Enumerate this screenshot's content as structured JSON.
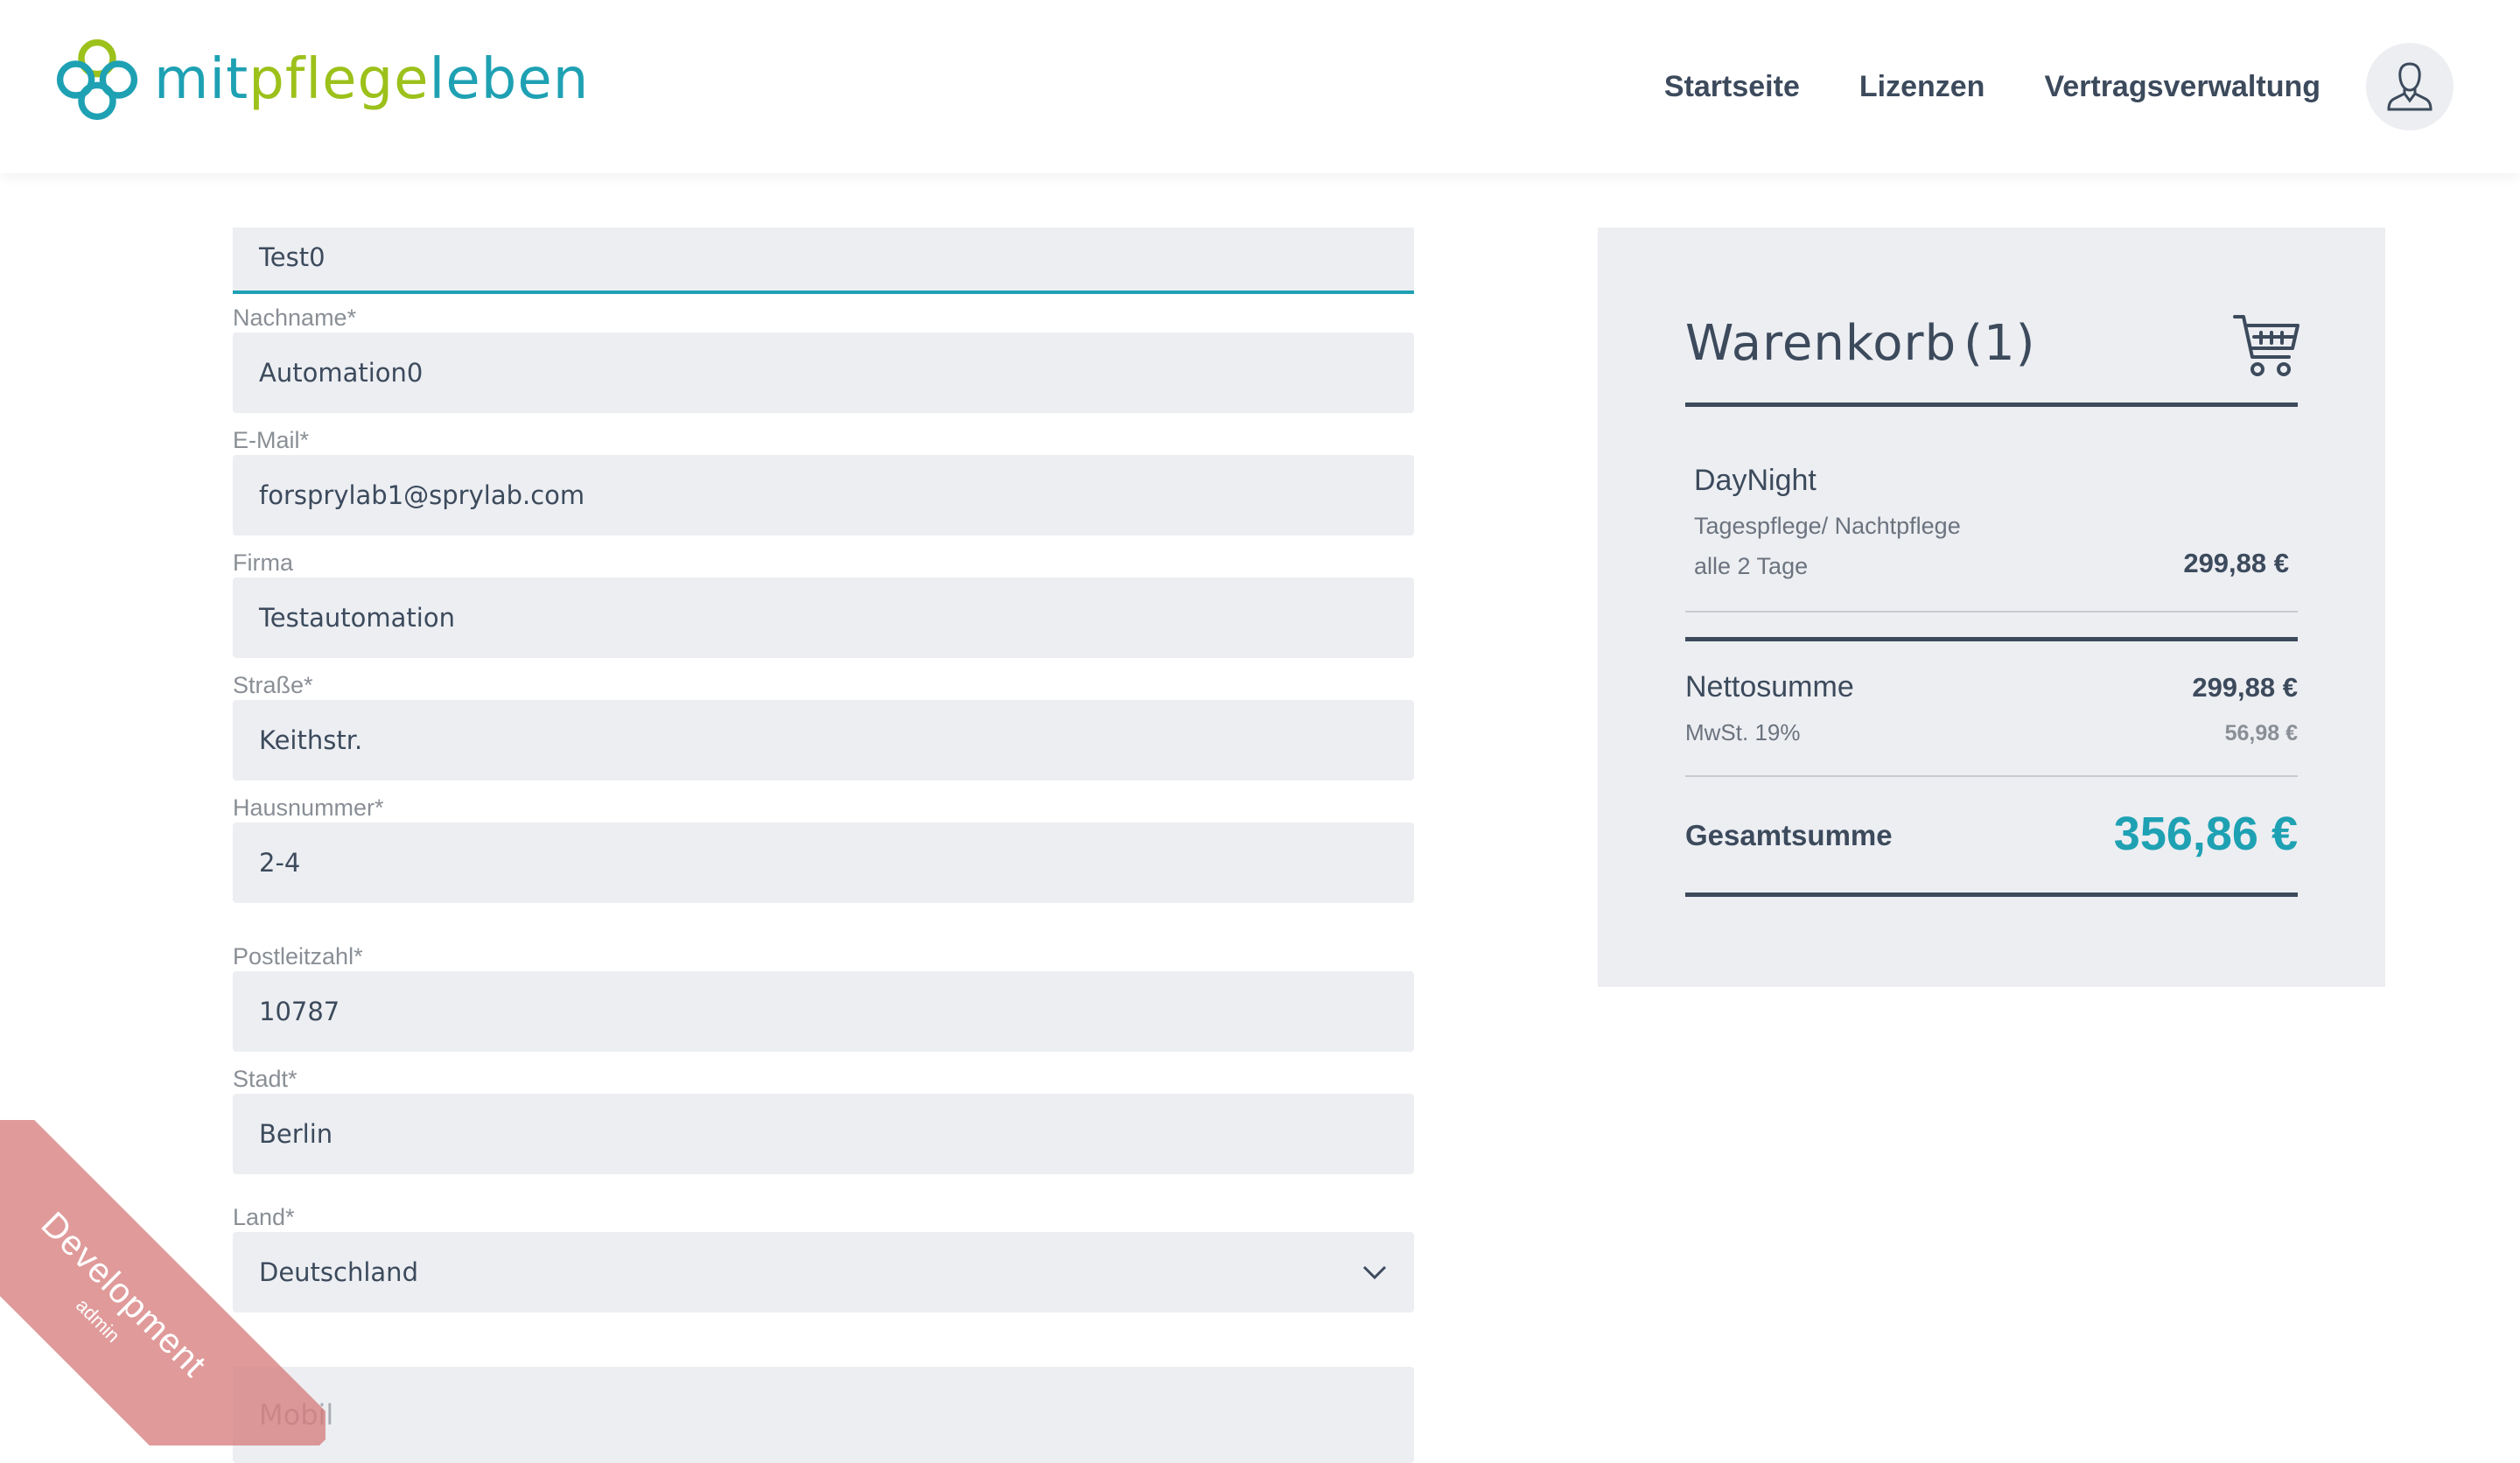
{
  "brand": {
    "name_part1": "mit",
    "name_part2": "pflege",
    "name_part3": "leben",
    "primary_color": "#1ea1b3",
    "secondary_color": "#9cc11a"
  },
  "nav": {
    "items": [
      "Startseite",
      "Lizenzen",
      "Vertragsverwaltung"
    ],
    "avatar_icon": "user-icon"
  },
  "form": {
    "fields": [
      {
        "label": "",
        "value": "Test0"
      },
      {
        "label": "Nachname*",
        "value": "Automation0"
      },
      {
        "label": "E-Mail*",
        "value": "forsprylab1@sprylab.com"
      },
      {
        "label": "Firma",
        "value": "Testautomation"
      },
      {
        "label": "Straße*",
        "value": "Keithstr."
      },
      {
        "label": "Hausnummer*",
        "value": "2-4"
      },
      {
        "label": "Postleitzahl*",
        "value": "10787"
      },
      {
        "label": "Stadt*",
        "value": "Berlin"
      },
      {
        "label": "Land*",
        "value": "Deutschland"
      },
      {
        "label": "",
        "placeholder": "Mobil"
      }
    ]
  },
  "cart": {
    "title": "Warenkorb",
    "count": "(1)",
    "icon": "cart-icon",
    "item": {
      "name": "DayNight",
      "type": "Tagespflege/ Nachtpflege",
      "interval": "alle 2 Tage",
      "price": "299,88 €"
    },
    "netto_label": "Nettosumme",
    "netto_value": "299,88 €",
    "mwst_label": "MwSt. 19%",
    "mwst_value": "56,98 €",
    "gesamt_label": "Gesamtsumme",
    "gesamt_value": "356,86 €"
  },
  "ribbon": {
    "env": "Development",
    "role": "admin"
  }
}
